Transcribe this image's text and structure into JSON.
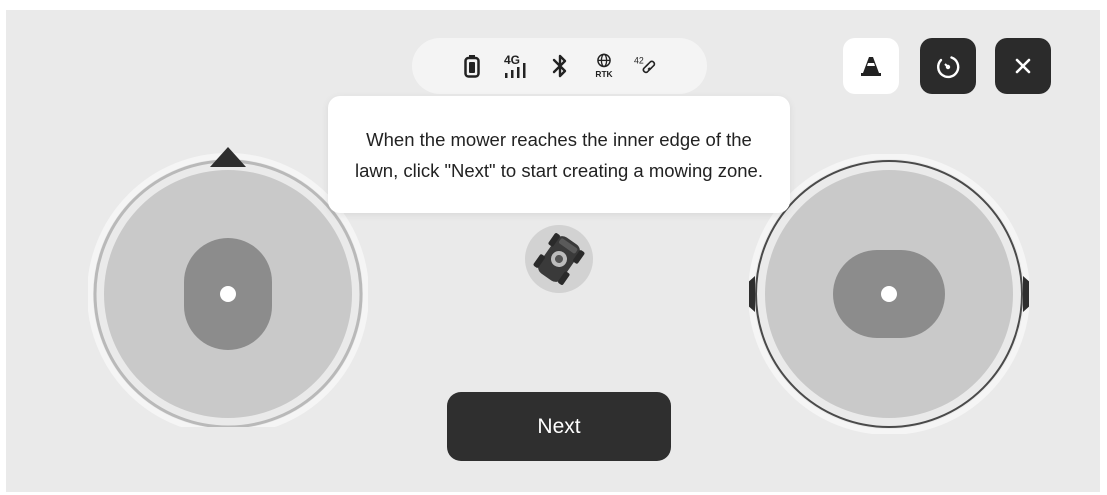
{
  "status_bar": {
    "icons": [
      "battery-icon",
      "cellular-4g-icon",
      "bluetooth-icon",
      "rtk-icon",
      "satellite-link-icon"
    ],
    "network_label": "4G",
    "rtk_label": "RTK",
    "satellite_count": "42"
  },
  "toolbar": {
    "cone_icon": "traffic-cone-icon",
    "reset_icon": "rotate-reset-icon",
    "close_icon": "close-icon"
  },
  "tooltip": {
    "message": "When the mower reaches the inner edge of the lawn, click \"Next\" to start creating a mowing zone."
  },
  "actions": {
    "next_label": "Next"
  },
  "joysticks": {
    "left": "vertical-joystick",
    "right": "horizontal-joystick"
  },
  "colors": {
    "background": "#eaeaea",
    "button_dark": "#2b2b2b",
    "joystick_outer": "#c9c9c9",
    "joystick_knob": "#8c8c8c"
  }
}
